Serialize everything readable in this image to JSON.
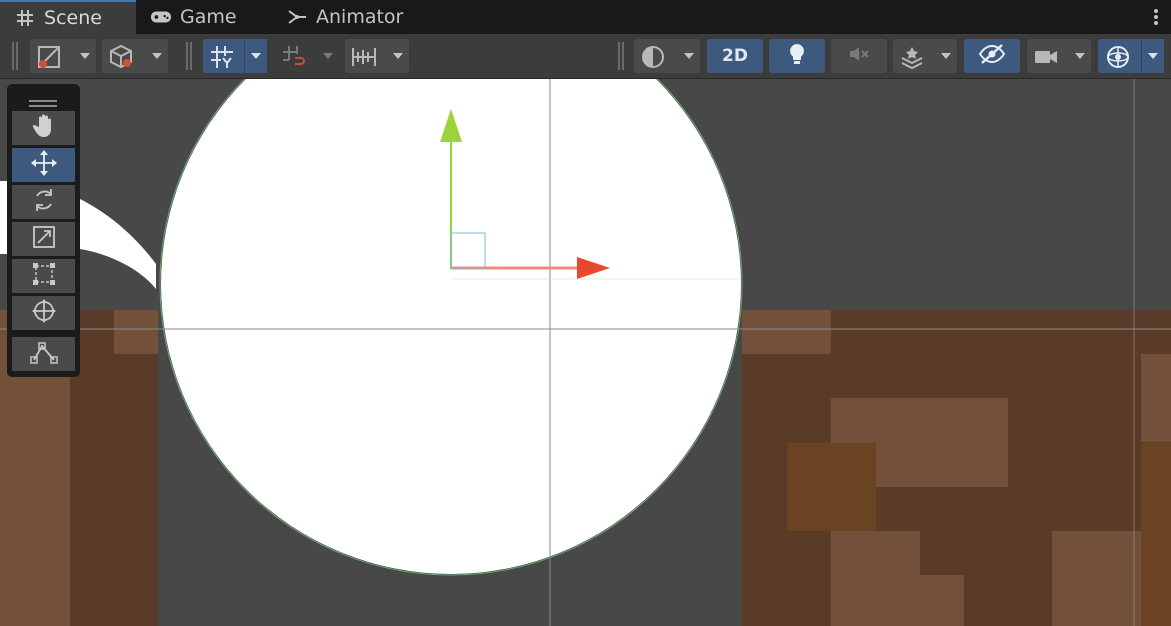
{
  "tabs": [
    {
      "label": "Scene",
      "icon": "grid-hash-icon",
      "active": true
    },
    {
      "label": "Game",
      "icon": "gamepad-icon",
      "active": false
    },
    {
      "label": "Animator",
      "icon": "animator-icon",
      "active": false
    }
  ],
  "toolbar": {
    "mode_2d_label": "2D",
    "buttons": [
      "draw-mode-icon",
      "shading-cube-icon",
      "grid-snap-icon",
      "increment-snap-icon",
      "ruler-icon",
      "render-sphere-icon",
      "lighting-bulb-icon",
      "audio-mute-icon",
      "effects-layers-icon",
      "visibility-eye-icon",
      "camera-icon",
      "gizmos-icon"
    ]
  },
  "tool_palette": {
    "tools": [
      "hand-icon",
      "move-icon",
      "rotate-icon",
      "scale-icon",
      "rect-icon",
      "transform-icon",
      "custom-tool-icon"
    ],
    "active_tool": "move-icon"
  },
  "colors": {
    "active_accent": "#3d5a7e",
    "tab_accent": "#3a79bb",
    "x_axis": "#e8482c",
    "y_axis": "#9ad33a",
    "dirt_dark": "#5a3b28",
    "dirt_light": "#72503a",
    "dirt_orange": "#6a4422",
    "background": "#484848"
  }
}
